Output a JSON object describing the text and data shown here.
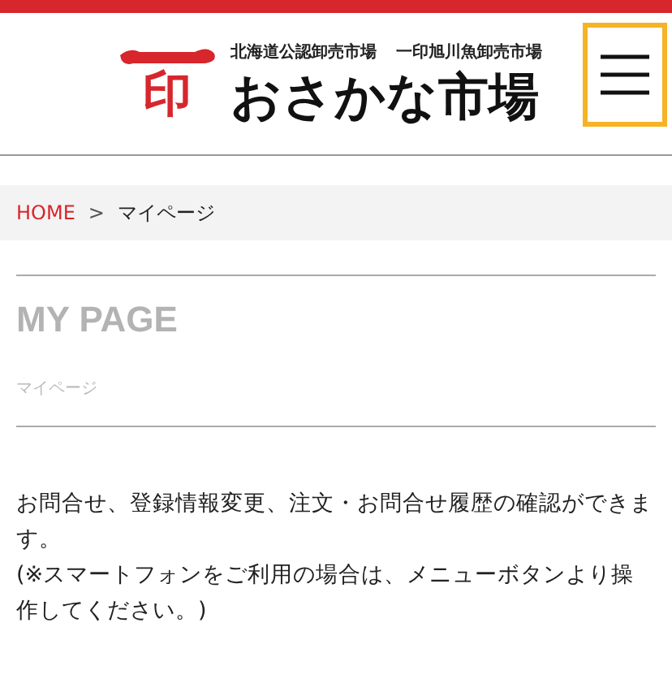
{
  "header": {
    "logo_mark": "印",
    "tagline": [
      "北海道公認卸売市場",
      "一印旭川魚卸売市場"
    ],
    "site_name": "おさかな市場",
    "menu_button": {
      "focused": true
    }
  },
  "breadcrumb": [
    {
      "label": "HOME",
      "kind": "link"
    },
    {
      "label": "マイページ",
      "kind": "current"
    }
  ],
  "breadcrumb_separator": ">",
  "page_title": "MY PAGE",
  "page_subtitle": "マイページ",
  "paragraphs": [
    "お問合せ、登録情報変更、注文・お問合せ履歴の確認ができます。",
    "(※スマートフォンをご利用の場合は、メニューボタンより操作してください。)"
  ]
}
